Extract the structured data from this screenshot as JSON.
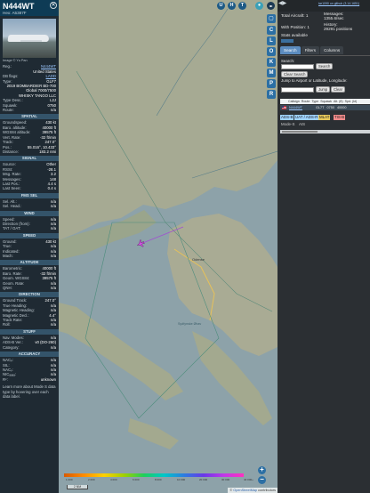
{
  "aircraft": {
    "callsign": "N444WT",
    "hex_label": "Hex:",
    "hex": "A5387F",
    "photo_credit": "Image © Yu Pan",
    "registration": "N444WT",
    "country": "United States",
    "db_flags": "LADD",
    "type_code": "GLF7",
    "type_desc": "2019 BOMBARDIER BD-700 Global 7000/7500",
    "owner": "WHISKY TANGO LLC",
    "type_desc_short": "L2J",
    "squawk": "0750",
    "route": "n/a"
  },
  "labels": {
    "reg": "Reg.:",
    "db_flags": "DB flags:",
    "type": "Type:",
    "type_desc": "Type Desc.:",
    "squawk": "Squawk:",
    "route": "Route:"
  },
  "sections": {
    "spatial": {
      "title": "SPATIAL",
      "rows": [
        {
          "label": "Groundspeed:",
          "value": "430 kt"
        },
        {
          "label": "Baro. altitude:",
          "value": "40000 ft"
        },
        {
          "label": "WGS84 altitude:",
          "value": "39575 ft"
        },
        {
          "label": "Vert. Rate:",
          "value": "-32 ft/min"
        },
        {
          "label": "Track:",
          "value": "247.0°"
        },
        {
          "label": "Pos.:",
          "value": "55.016°, 10.433°"
        },
        {
          "label": "Distance:",
          "value": "183.2 nmi"
        }
      ]
    },
    "signal": {
      "title": "SIGNAL",
      "rows": [
        {
          "label": "Source:",
          "value": "Other"
        },
        {
          "label": "RSSI:",
          "value": "-28.1"
        },
        {
          "label": "Msg. Rate:",
          "value": "3.2"
        },
        {
          "label": "Messages:",
          "value": "148"
        },
        {
          "label": "Last Pos.:",
          "value": "4.4 s"
        },
        {
          "label": "Last Seen:",
          "value": "0.4 s"
        }
      ]
    },
    "fms": {
      "title": "FMS SEL",
      "rows": [
        {
          "label": "Sel. Alt.:",
          "value": "n/a"
        },
        {
          "label": "Sel. Head.:",
          "value": "n/a"
        }
      ]
    },
    "wind": {
      "title": "WIND",
      "rows": [
        {
          "label": "Speed:",
          "value": "n/a"
        },
        {
          "label": "Direction (from):",
          "value": "n/a"
        },
        {
          "label": "TAT / OAT:",
          "value": "n/a"
        }
      ]
    },
    "speed": {
      "title": "SPEED",
      "rows": [
        {
          "label": "Ground:",
          "value": "430 kt"
        },
        {
          "label": "True:",
          "value": "n/a"
        },
        {
          "label": "Indicated:",
          "value": "n/a"
        },
        {
          "label": "Mach:",
          "value": "n/a"
        }
      ]
    },
    "altitude": {
      "title": "ALTITUDE",
      "rows": [
        {
          "label": "Barometric:",
          "value": "40000 ft"
        },
        {
          "label": "Baro. Rate:",
          "value": "-32 ft/min"
        },
        {
          "label": "Geom. WGS84:",
          "value": "39575 ft"
        },
        {
          "label": "Geom. Rate:",
          "value": "n/a"
        },
        {
          "label": "QNH:",
          "value": "n/a"
        }
      ]
    },
    "direction": {
      "title": "DIRECTION",
      "rows": [
        {
          "label": "Ground Track:",
          "value": "247.0°"
        },
        {
          "label": "True Heading:",
          "value": "n/a"
        },
        {
          "label": "Magnetic Heading:",
          "value": "n/a"
        },
        {
          "label": "Magnetic Decl.:",
          "value": "4.4°"
        },
        {
          "label": "Track Rate:",
          "value": "n/a"
        },
        {
          "label": "Roll:",
          "value": "n/a"
        }
      ]
    },
    "stuff": {
      "title": "STUFF",
      "rows": [
        {
          "label": "Nav. Modes:",
          "value": "n/a"
        },
        {
          "label": "ADS-B Ver.:",
          "value": "v0 (DO-260)"
        },
        {
          "label": "Category:",
          "value": "n/a"
        }
      ]
    },
    "accuracy": {
      "title": "ACCURACY",
      "rows": [
        {
          "label": "NACₚ:",
          "value": "n/a"
        },
        {
          "label": "SIL:",
          "value": "n/a"
        },
        {
          "label": "NACᵥ:",
          "value": "n/a"
        },
        {
          "label": "NICₐₐₐₐ:",
          "value": "n/a"
        },
        {
          "label": "Rᶜ:",
          "value": "unknown"
        }
      ]
    },
    "note": "Learn more about Mode S data type by hovering over each data label."
  },
  "map": {
    "top_buttons": [
      "U",
      "H",
      "T"
    ],
    "tool_buttons": [
      "C",
      "L",
      "O",
      "K",
      "M",
      "P",
      "R"
    ],
    "city_label": "Odense",
    "water_label": "Sydfynske Øhav",
    "zoom_in": "+",
    "zoom_out": "−",
    "attribution_prefix": "© ",
    "attribution_link": "OpenStreetMap",
    "attribution_suffix": " contributors",
    "scale": "2 NM",
    "alt_ticks": [
      "1 000",
      "2 000",
      "4 000",
      "6 000",
      "8 000",
      "10 000",
      "20 000",
      "30 000",
      "40 000+"
    ]
  },
  "right_panel": {
    "version": "tar1090 on github (3.14.1651)",
    "total_aircraft_label": "Total Aircraft:",
    "total_aircraft": "1",
    "messages_label": "Messages:",
    "messages": "1355.6/sec",
    "with_position_label": "With Position:",
    "with_position": "1",
    "history_label": "History:",
    "history": "29291 positions",
    "stats_label": "Stats available",
    "tabs": [
      "Search",
      "Filters",
      "Columns"
    ],
    "search_label": "Search:",
    "search_button": "Search",
    "clear_search": "Clear Search",
    "jump_label": "Jump to Airport or Latitude, Longitude:",
    "jump_button": "Jump",
    "clear_button": "Clear",
    "columns": [
      "Callsign",
      "Route",
      "Type",
      "Squawk",
      "Alt. (ft)",
      "Spd. (kt)"
    ],
    "row": {
      "callsign": "N444WT",
      "type": "GL7T",
      "squawk": "0750",
      "altitude": "40000"
    },
    "chips": [
      "ADS-B",
      "UAT / ADS-R",
      "MLAT",
      "TIS-B",
      "Mode-S",
      "AIS"
    ],
    "chip_colors": {
      "ADS-B": "#9fd3ff",
      "UAT / ADS-R": "#9fd3ff",
      "MLAT": "#e6c85a",
      "TIS-B": "#f38b8b",
      "Mode-S": "#c9c9c9",
      "AIS": "#c9c9c9"
    }
  }
}
